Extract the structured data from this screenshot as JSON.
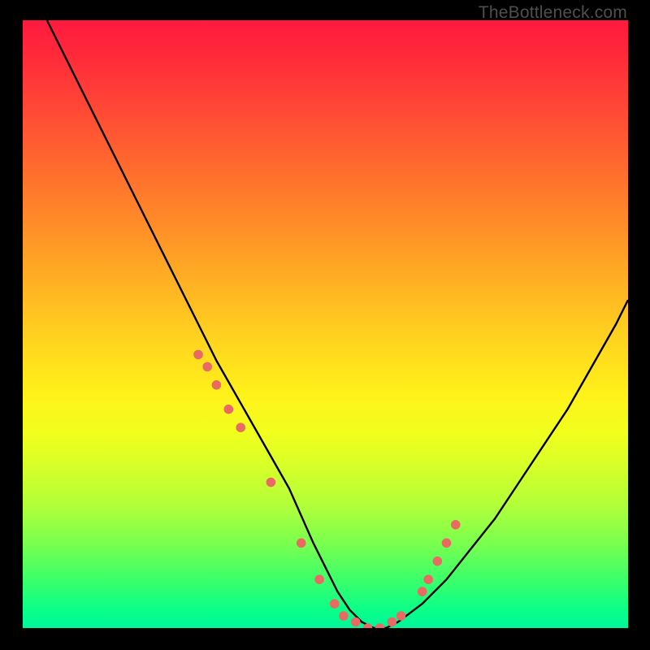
{
  "attribution": "TheBottleneck.com",
  "colors": {
    "background": "#000000",
    "curve": "#000000",
    "markers": "#e86a62",
    "attribution_text": "#4f4f4f"
  },
  "chart_data": {
    "type": "line",
    "title": "",
    "xlabel": "",
    "ylabel": "",
    "xlim": [
      0,
      100
    ],
    "ylim": [
      0,
      100
    ],
    "grid": false,
    "legend": false,
    "series": [
      {
        "name": "bottleneck-curve",
        "x": [
          4,
          8,
          12,
          16,
          20,
          24,
          28,
          32,
          36,
          40,
          44,
          48,
          50,
          52,
          54,
          56,
          58,
          60,
          62,
          66,
          70,
          74,
          78,
          82,
          86,
          90,
          94,
          98,
          100
        ],
        "y": [
          100,
          92,
          84,
          76,
          68,
          60,
          52,
          44,
          37,
          30,
          23,
          14,
          10,
          6,
          3,
          1,
          0,
          0,
          1,
          4,
          8,
          13,
          18,
          24,
          30,
          36,
          43,
          50,
          54
        ]
      }
    ],
    "markers": {
      "name": "highlighted-points",
      "x": [
        29,
        30.5,
        32,
        34,
        36,
        41,
        46,
        49,
        51.5,
        53,
        55,
        57,
        59,
        61,
        62.5,
        66,
        67,
        68.5,
        70,
        71.5
      ],
      "y": [
        45,
        43,
        40,
        36,
        33,
        24,
        14,
        8,
        4,
        2,
        1,
        0,
        0,
        1,
        2,
        6,
        8,
        11,
        14,
        17
      ]
    }
  }
}
